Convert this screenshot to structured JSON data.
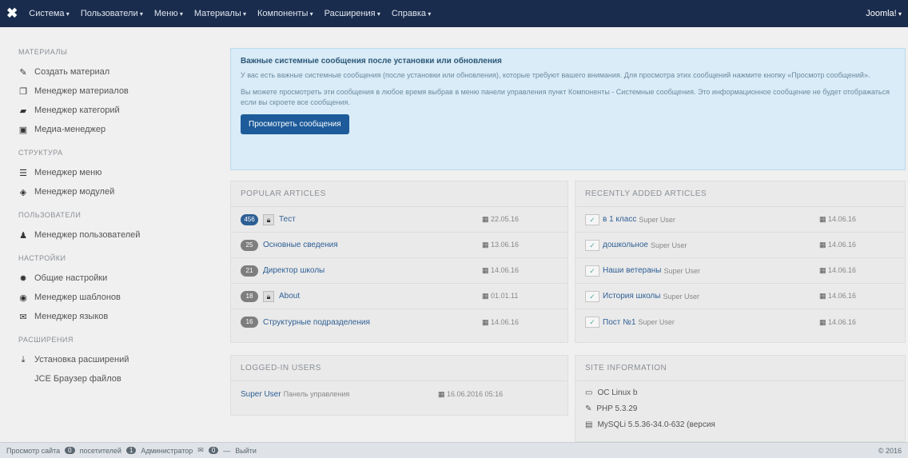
{
  "topbar": {
    "logo_glyph": "✖",
    "menu": [
      "Система",
      "Пользователи",
      "Меню",
      "Материалы",
      "Компоненты",
      "Расширения",
      "Справка"
    ],
    "right": "Joomla!"
  },
  "sidebar": {
    "sections": [
      {
        "title": "МАТЕРИАЛЫ",
        "items": [
          {
            "icon": "pencil-icon",
            "glyph": "✎",
            "label": "Создать материал"
          },
          {
            "icon": "copy-icon",
            "glyph": "❐",
            "label": "Менеджер материалов"
          },
          {
            "icon": "folder-icon",
            "glyph": "▰",
            "label": "Менеджер категорий"
          },
          {
            "icon": "image-icon",
            "glyph": "▣",
            "label": "Медиа-менеджер"
          }
        ]
      },
      {
        "title": "СТРУКТУРА",
        "items": [
          {
            "icon": "list-icon",
            "glyph": "☰",
            "label": "Менеджер меню"
          },
          {
            "icon": "cube-icon",
            "glyph": "◈",
            "label": "Менеджер модулей"
          }
        ]
      },
      {
        "title": "ПОЛЬЗОВАТЕЛИ",
        "items": [
          {
            "icon": "users-icon",
            "glyph": "♟",
            "label": "Менеджер пользователей"
          }
        ]
      },
      {
        "title": "НАСТРОЙКИ",
        "items": [
          {
            "icon": "gear-icon",
            "glyph": "✹",
            "label": "Общие настройки"
          },
          {
            "icon": "eye-icon",
            "glyph": "◉",
            "label": "Менеджер шаблонов"
          },
          {
            "icon": "comments-icon",
            "glyph": "✉",
            "label": "Менеджер языков"
          }
        ]
      },
      {
        "title": "РАСШИРЕНИЯ",
        "items": [
          {
            "icon": "upload-icon",
            "glyph": "⤓",
            "label": "Установка расширений"
          },
          {
            "icon": "",
            "glyph": "",
            "label": "JCE Браузер файлов"
          }
        ]
      }
    ]
  },
  "alert": {
    "title": "Важные системные сообщения после установки или обновления",
    "p1": "У вас есть важные системные сообщения (после установки или обновления), которые требуют вашего внимания. Для просмотра этих сообщений нажмите кнопку «Просмотр сообщений».",
    "p2": "Вы можете просмотреть эти сообщения в любое время выбрав в меню панели управления пункт Компоненты - Системные сообщения. Это информационное сообщение не будет отображаться если вы скроете все сообщения.",
    "button": "Просмотреть сообщения"
  },
  "popular": {
    "title": "POPULAR ARTICLES",
    "rows": [
      {
        "hits": "456",
        "locked": true,
        "title": "Тест",
        "date": "22.05.16"
      },
      {
        "hits": "25",
        "locked": false,
        "title": "Основные сведения",
        "date": "13.06.16"
      },
      {
        "hits": "21",
        "locked": false,
        "title": "Директор школы",
        "date": "14.06.16"
      },
      {
        "hits": "18",
        "locked": true,
        "title": "About",
        "date": "01.01.11"
      },
      {
        "hits": "16",
        "locked": false,
        "title": "Структурные подразделения",
        "date": "14.06.16"
      }
    ]
  },
  "recent": {
    "title": "RECENTLY ADDED ARTICLES",
    "rows": [
      {
        "title": "в 1 класс",
        "by": "Super User",
        "date": "14.06.16"
      },
      {
        "title": "дошкольное",
        "by": "Super User",
        "date": "14.06.16"
      },
      {
        "title": "Наши ветераны",
        "by": "Super User",
        "date": "14.06.16"
      },
      {
        "title": "История школы",
        "by": "Super User",
        "date": "14.06.16"
      },
      {
        "title": "Пост №1",
        "by": "Super User",
        "date": "14.06.16"
      }
    ]
  },
  "logged": {
    "title": "LOGGED-IN USERS",
    "rows": [
      {
        "user": "Super User",
        "where": "Панель управления",
        "date": "16.06.2016 05:16"
      }
    ]
  },
  "siteinfo": {
    "title": "SITE INFORMATION",
    "rows": [
      {
        "icon": "monitor-icon",
        "glyph": "▭",
        "text": "ОС Linux b"
      },
      {
        "icon": "wrench-icon",
        "glyph": "✎",
        "text": "PHP 5.3.29"
      },
      {
        "icon": "database-icon",
        "glyph": "▤",
        "text": "MySQLi 5.5.36-34.0-632 (версия"
      }
    ]
  },
  "statusbar": {
    "view_site": "Просмотр сайта",
    "visitors_count": "0",
    "visitors": "посетителей",
    "admins_count": "1",
    "admins": "Администратор",
    "messages_count": "0",
    "logout": "Выйти",
    "copyright": "© 2016"
  }
}
